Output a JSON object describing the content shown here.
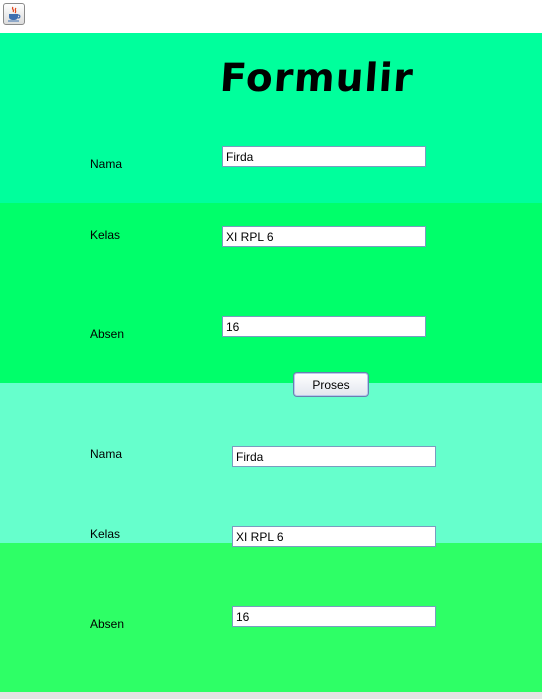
{
  "window": {
    "icon": "java-cup-icon"
  },
  "form": {
    "title": "Formulir",
    "name_label": "Nama",
    "name_value": "Firda",
    "class_label": "Kelas",
    "class_value": "XI RPL 6",
    "number_label": "Absen",
    "number_value": "16",
    "process_button": "Proses"
  },
  "output": {
    "name_label": "Nama",
    "name_value": "Firda",
    "class_label": "Kelas",
    "class_value": "XI RPL 6",
    "number_label": "Absen",
    "number_value": "16"
  },
  "colors": {
    "band1": "#00ff9c",
    "band2": "#00ff6a",
    "band3": "#66ffcc",
    "band4": "#2eff66"
  }
}
